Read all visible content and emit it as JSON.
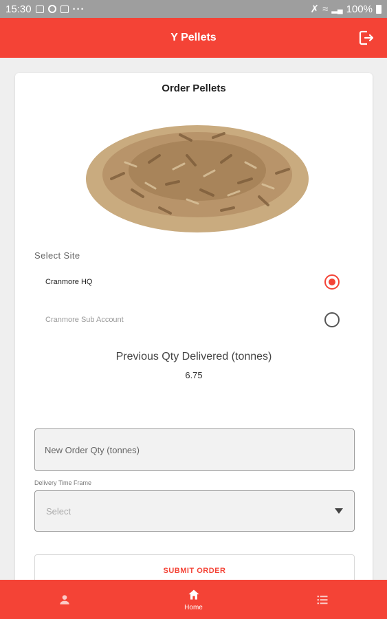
{
  "status_bar": {
    "time": "15:30",
    "battery": "100%"
  },
  "app_bar": {
    "title": "Y Pellets",
    "logout_icon": "logout-icon"
  },
  "card": {
    "title": "Order Pellets",
    "image": "wood-pellets-pile",
    "select_site_label": "Select Site",
    "sites": [
      {
        "label": "Cranmore HQ",
        "selected": true
      },
      {
        "label": "Cranmore Sub Account",
        "selected": false
      }
    ],
    "previous_qty_label": "Previous Qty Delivered (tonnes)",
    "previous_qty_value": "6.75",
    "new_order_placeholder": "New Order Qty (tonnes)",
    "delivery_label": "Delivery Time Frame",
    "delivery_value": "Select",
    "submit_label": "SUBMIT ORDER"
  },
  "bottom_nav": {
    "items": [
      {
        "icon": "person-icon",
        "label": ""
      },
      {
        "icon": "home-icon",
        "label": "Home",
        "active": true
      },
      {
        "icon": "list-icon",
        "label": ""
      }
    ]
  },
  "colors": {
    "accent": "#f44336",
    "status_bar": "#9e9e9e"
  }
}
